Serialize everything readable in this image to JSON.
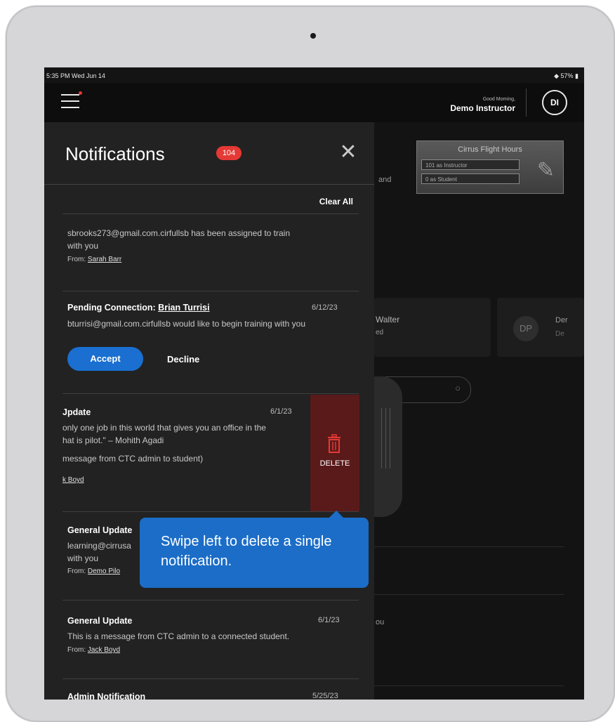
{
  "status": {
    "time": "5:35 PM  Wed Jun 14",
    "battery": "◆ 57% ▮"
  },
  "header": {
    "greeting": "Good Morning,",
    "user_name": "Demo Instructor",
    "avatar_initials": "DI"
  },
  "background": {
    "hours_title": "Cirrus Flight Hours",
    "hours_instructor": "101 as Instructor",
    "hours_student": "0 as Student",
    "text_and": "and",
    "card_name": "Walter",
    "card_sub": "ed",
    "dp_initials": "DP",
    "dp_name": "Der",
    "dp_sub": "De",
    "text_ou": "ou"
  },
  "panel": {
    "title": "Notifications",
    "badge": "104",
    "clear_all": "Clear All",
    "n1_text1": "sbrooks273@gmail.com.cirfullsb has been assigned to train",
    "n1_text2": "with you",
    "n1_from_label": "From:",
    "n1_from_name": "Sarah Barr",
    "n2_title_prefix": "Pending Connection:",
    "n2_title_name": "Brian Turrisi",
    "n2_date": "6/12/23",
    "n2_text": "bturrisi@gmail.com.cirfullsb would like to begin training with you",
    "accept": "Accept",
    "decline": "Decline",
    "n3_title": "Jpdate",
    "n3_date": "6/1/23",
    "n3_text1": "only one job in this world that gives you an office in the",
    "n3_text2": "hat is pilot.\" – Mohith Agadi",
    "n3_text3": "message from CTC admin to student)",
    "n3_from_name": "k Boyd",
    "delete": "DELETE",
    "n4_title": "General Update",
    "n4_text1": "learning@cirrusa",
    "n4_text2": "with you",
    "n4_from_label": "From:",
    "n4_from_name": "Demo Pilo",
    "n5_title": "General Update",
    "n5_date": "6/1/23",
    "n5_text": "This is a message from CTC admin to a connected student.",
    "n5_from_label": "From:",
    "n5_from_name": "Jack Boyd",
    "n6_title": "Admin Notification",
    "n6_date": "5/25/23"
  },
  "tooltip": {
    "text": "Swipe left to delete a single notification."
  },
  "colors": {
    "accent_blue": "#1a6fd0",
    "badge_red": "#e53935",
    "delete_bg": "#5a1a1a",
    "tooltip_blue": "#1b6dc7"
  }
}
